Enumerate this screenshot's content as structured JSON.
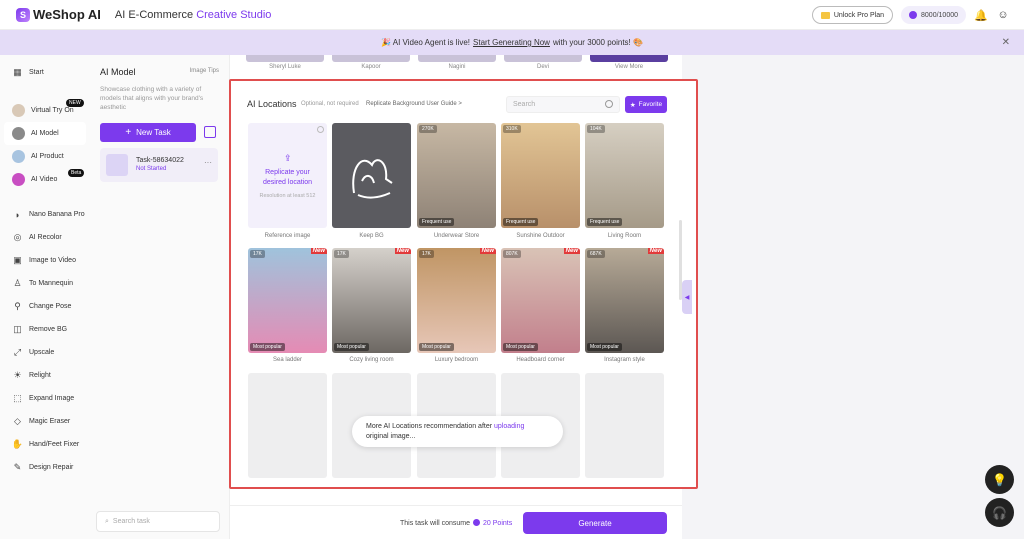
{
  "header": {
    "logo": "WeShop AI",
    "studio_prefix": "AI E-Commerce",
    "studio_accent": "Creative Studio",
    "pro_label": "Unlock Pro Plan",
    "points_label": "8000/10000"
  },
  "banner": {
    "prefix": "🎉 AI Video Agent is live!",
    "link": "Start Generating Now",
    "suffix": "with your 3000 points! 🎨"
  },
  "sidebar": {
    "items": [
      {
        "label": "Start",
        "icon": "grid-icon"
      },
      {
        "label": "Virtual Try On",
        "icon": "tryon-icon",
        "badge": "NEW"
      },
      {
        "label": "AI Model",
        "icon": "model-icon"
      },
      {
        "label": "AI Product",
        "icon": "product-icon"
      },
      {
        "label": "AI Video",
        "icon": "video-icon",
        "badge": "Beta"
      },
      {
        "label": "Nano Banana Pro",
        "icon": "banana-icon"
      },
      {
        "label": "AI Recolor",
        "icon": "recolor-icon"
      },
      {
        "label": "Image to Video",
        "icon": "img-video-icon"
      },
      {
        "label": "To Mannequin",
        "icon": "mannequin-icon"
      },
      {
        "label": "Change Pose",
        "icon": "pose-icon"
      },
      {
        "label": "Remove BG",
        "icon": "remove-bg-icon"
      },
      {
        "label": "Upscale",
        "icon": "upscale-icon"
      },
      {
        "label": "Relight",
        "icon": "relight-icon"
      },
      {
        "label": "Expand Image",
        "icon": "expand-icon"
      },
      {
        "label": "Magic Eraser",
        "icon": "eraser-icon"
      },
      {
        "label": "Hand/Feet Fixer",
        "icon": "hand-icon"
      },
      {
        "label": "Design Repair",
        "icon": "repair-icon"
      }
    ]
  },
  "panel": {
    "title": "AI Model",
    "tips": "Image Tips",
    "description": "Showcase clothing with a variety of models that aligns with your brand's aesthetic",
    "new_task": "New Task",
    "task_name": "Task-58634022",
    "task_status": "Not Started",
    "search_placeholder": "Search task"
  },
  "models_strip": [
    "Sheryl Luke",
    "Kapoor",
    "Nagini",
    "Devi",
    "View More"
  ],
  "locations": {
    "title": "AI Locations",
    "optional": "Optional, not required",
    "guide": "Replicate Background User Guide >",
    "search_placeholder": "Search",
    "favorite": "Favorite",
    "reference": {
      "line1": "Replicate your",
      "line2": "desired location",
      "sub": "Resolution at least 512",
      "label": "Reference image"
    },
    "keep_bg": "Keep BG",
    "row1": [
      {
        "label": "Underwear Store",
        "count": "270K",
        "tag": "Frequent use",
        "color": "#b9a58e"
      },
      {
        "label": "Sunshine Outdoor",
        "count": "310K",
        "tag": "Frequent use",
        "color": "#d8b98a"
      },
      {
        "label": "Living Room",
        "count": "104K",
        "tag": "Frequent use",
        "color": "#c8bfae"
      }
    ],
    "row2": [
      {
        "label": "Sea ladder",
        "count": "17K",
        "tag": "Most popular",
        "new": "New",
        "color": "#d97fa8"
      },
      {
        "label": "Cozy living room",
        "count": "17K",
        "tag": "Most popular",
        "new": "New",
        "color": "#9c9590"
      },
      {
        "label": "Luxury bedroom",
        "count": "17K",
        "tag": "Most popular",
        "new": "New",
        "color": "#b58d63"
      },
      {
        "label": "Headboard corner",
        "count": "807K",
        "tag": "Most popular",
        "new": "New",
        "color": "#c99aa0"
      },
      {
        "label": "Instagram style",
        "count": "687K",
        "tag": "Most popular",
        "new": "New",
        "color": "#8f857a"
      }
    ],
    "toast_prefix": "More AI Locations recommendation after",
    "toast_link": "uploading",
    "toast_suffix": "original image..."
  },
  "footer": {
    "consume_prefix": "This task will consume",
    "consume_points": "20 Points",
    "generate": "Generate"
  }
}
